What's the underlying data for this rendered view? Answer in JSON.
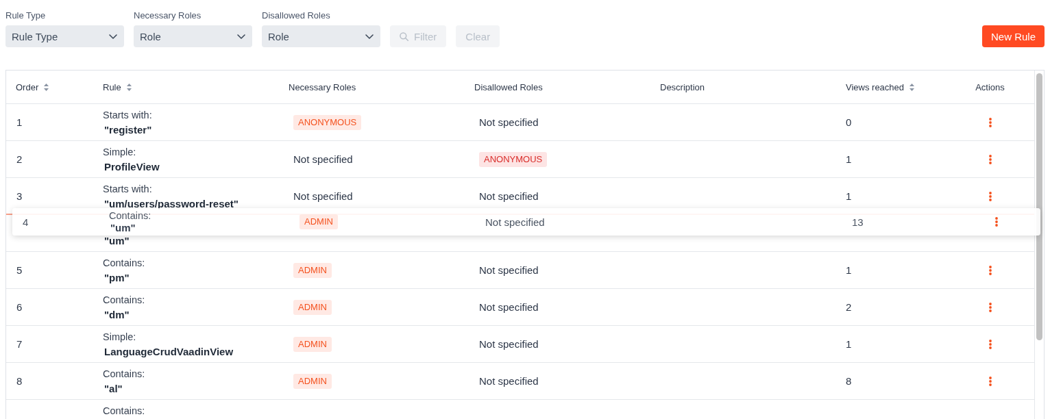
{
  "filters": [
    {
      "label": "Rule Type",
      "placeholder": "Rule Type"
    },
    {
      "label": "Necessary Roles",
      "placeholder": "Role"
    },
    {
      "label": "Disallowed Roles",
      "placeholder": "Role"
    }
  ],
  "filter_button": {
    "label": "Filter",
    "disabled": true
  },
  "clear_button": {
    "label": "Clear",
    "disabled": true
  },
  "new_rule_button": {
    "label": "New Rule"
  },
  "table": {
    "columns": [
      {
        "label": "Order",
        "sortable": true
      },
      {
        "label": "Rule",
        "sortable": true
      },
      {
        "label": "Necessary Roles",
        "sortable": false
      },
      {
        "label": "Disallowed Roles",
        "sortable": false
      },
      {
        "label": "Description",
        "sortable": false
      },
      {
        "label": "Views reached",
        "sortable": true
      },
      {
        "label": "Actions",
        "sortable": false
      }
    ],
    "rows": [
      {
        "kind": "rule",
        "order": "1",
        "rule_type": "Starts with:",
        "rule_value": "\"register\"",
        "necessary_roles": {
          "kind": "badge",
          "text": "ANONYMOUS"
        },
        "disallowed_roles": {
          "kind": "text",
          "text": "Not specified"
        },
        "views": "0",
        "drop_target": false
      },
      {
        "kind": "rule",
        "order": "2",
        "rule_type": "Simple:",
        "rule_value": "ProfileView",
        "necessary_roles": {
          "kind": "text",
          "text": "Not specified"
        },
        "disallowed_roles": {
          "kind": "badge",
          "text": "ANONYMOUS"
        },
        "views": "1",
        "drop_target": false
      },
      {
        "kind": "rule",
        "order": "3",
        "rule_type": "Starts with:",
        "rule_value": "\"um/users/password-reset\"",
        "necessary_roles": {
          "kind": "text",
          "text": "Not specified"
        },
        "disallowed_roles": {
          "kind": "text",
          "text": "Not specified"
        },
        "views": "1",
        "drop_target": false
      },
      {
        "kind": "drag_placeholder",
        "rule_value": "\"um\"",
        "drop_target": true
      },
      {
        "kind": "rule",
        "order": "5",
        "rule_type": "Contains:",
        "rule_value": "\"pm\"",
        "necessary_roles": {
          "kind": "badge",
          "text": "ADMIN"
        },
        "disallowed_roles": {
          "kind": "text",
          "text": "Not specified"
        },
        "views": "1",
        "drop_target": false
      },
      {
        "kind": "rule",
        "order": "6",
        "rule_type": "Contains:",
        "rule_value": "\"dm\"",
        "necessary_roles": {
          "kind": "badge",
          "text": "ADMIN"
        },
        "disallowed_roles": {
          "kind": "text",
          "text": "Not specified"
        },
        "views": "2",
        "drop_target": false
      },
      {
        "kind": "rule",
        "order": "7",
        "rule_type": "Simple:",
        "rule_value": "LanguageCrudVaadinView",
        "necessary_roles": {
          "kind": "badge",
          "text": "ADMIN"
        },
        "disallowed_roles": {
          "kind": "text",
          "text": "Not specified"
        },
        "views": "1",
        "drop_target": false
      },
      {
        "kind": "rule",
        "order": "8",
        "rule_type": "Contains:",
        "rule_value": "\"al\"",
        "necessary_roles": {
          "kind": "badge",
          "text": "ADMIN"
        },
        "disallowed_roles": {
          "kind": "text",
          "text": "Not specified"
        },
        "views": "8",
        "drop_target": false
      },
      {
        "kind": "cut_off",
        "rule_type": "Contains:",
        "drop_target": false
      }
    ],
    "drag_preview": {
      "order": "4",
      "rule_type": "Contains:",
      "rule_value": "\"um\"",
      "necessary_roles": {
        "kind": "badge",
        "text": "ADMIN"
      },
      "disallowed_roles": {
        "kind": "text",
        "text": "Not specified"
      },
      "views": "13"
    }
  }
}
